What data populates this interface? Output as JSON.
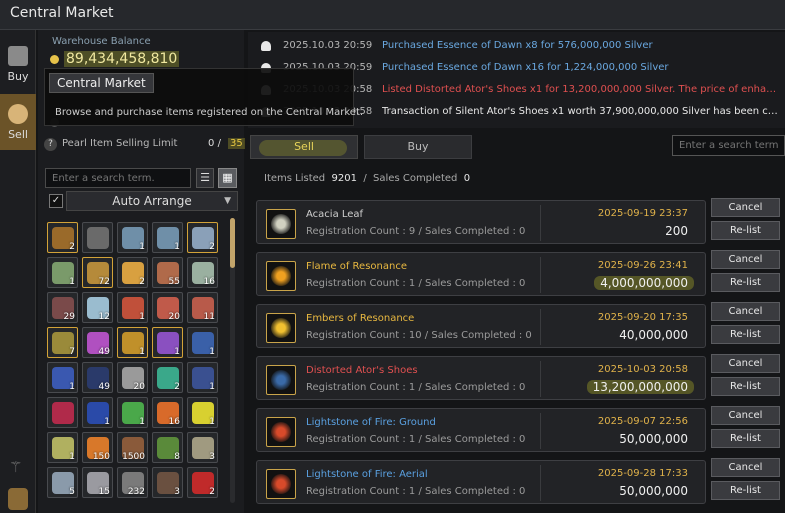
{
  "window": {
    "title": "Central Market"
  },
  "nav": {
    "buy_label": "Buy",
    "sell_label": "Sell"
  },
  "warehouse": {
    "label": "Warehouse Balance",
    "value": "89,434,458,810"
  },
  "tooltip": {
    "title": "Central Market",
    "description": "Browse and purchase items registered on the Central Market."
  },
  "pearl": {
    "label": "Pearl Item Selling Limit",
    "current": "0",
    "separator": "/",
    "max": "35"
  },
  "inventory": {
    "search_placeholder": "Enter a search term.",
    "auto_arrange": "Auto Arrange",
    "checkbox_mark": "✓",
    "slots": [
      {
        "icon": "necklace-icon",
        "count": "2",
        "color": "#9a6a2a",
        "gold": true
      },
      {
        "icon": "ring-icon",
        "count": "",
        "color": "#6a6a6a",
        "gold": false
      },
      {
        "icon": "crystal-icon",
        "count": "1",
        "color": "#6f8fa8",
        "gold": false
      },
      {
        "icon": "crystal-icon",
        "count": "1",
        "color": "#6f8fa8",
        "gold": false
      },
      {
        "icon": "crystal-icon",
        "count": "2",
        "color": "#8aa0b8",
        "gold": true
      },
      {
        "icon": "hoe-icon",
        "count": "1",
        "color": "#7a9a6a",
        "gold": false
      },
      {
        "icon": "treasure-map-icon",
        "count": "72",
        "color": "#b58a3a",
        "gold": true
      },
      {
        "icon": "potion-icon",
        "count": "2",
        "color": "#d8a040",
        "gold": false
      },
      {
        "icon": "seed-icon",
        "count": "55",
        "color": "#b06a4a",
        "gold": false
      },
      {
        "icon": "bottle-icon",
        "count": "16",
        "color": "#9ab0a0",
        "gold": false
      },
      {
        "icon": "meat-icon",
        "count": "29",
        "color": "#7a4a4a",
        "gold": false
      },
      {
        "icon": "feather-icon",
        "count": "12",
        "color": "#9abccf",
        "gold": false
      },
      {
        "icon": "mushroom-icon",
        "count": "1",
        "color": "#c0503a",
        "gold": false
      },
      {
        "icon": "mushroom-icon",
        "count": "20",
        "color": "#c05a4a",
        "gold": false
      },
      {
        "icon": "mushroom-icon",
        "count": "11",
        "color": "#b85a4a",
        "gold": false
      },
      {
        "icon": "key-icon",
        "count": "7",
        "color": "#9a8a3a",
        "gold": true
      },
      {
        "icon": "flask-icon",
        "count": "49",
        "color": "#b050c0",
        "gold": false
      },
      {
        "icon": "stone-icon",
        "count": "1",
        "color": "#c0902a",
        "gold": true
      },
      {
        "icon": "orb-icon",
        "count": "1",
        "color": "#8a50c0",
        "gold": true
      },
      {
        "icon": "gem-icon",
        "count": "1",
        "color": "#3a60a8",
        "gold": false
      },
      {
        "icon": "gem-icon",
        "count": "1",
        "color": "#3a58b0",
        "gold": false
      },
      {
        "icon": "gem-icon",
        "count": "49",
        "color": "#2a3a6a",
        "gold": false
      },
      {
        "icon": "scroll-icon",
        "count": "20",
        "color": "#9a9a9a",
        "gold": false
      },
      {
        "icon": "gem-icon",
        "count": "2",
        "color": "#3aa88a",
        "gold": false
      },
      {
        "icon": "gem-icon",
        "count": "1",
        "color": "#3a5090",
        "gold": false
      },
      {
        "icon": "gem-icon",
        "count": "",
        "color": "#b02a4a",
        "gold": false
      },
      {
        "icon": "gem-icon",
        "count": "1",
        "color": "#2a4aa8",
        "gold": false
      },
      {
        "icon": "leaf-icon",
        "count": "1",
        "color": "#4aa84a",
        "gold": false
      },
      {
        "icon": "carrot-icon",
        "count": "16",
        "color": "#d86a2a",
        "gold": false
      },
      {
        "icon": "coin-icon",
        "count": "1",
        "color": "#d8d030",
        "gold": false
      },
      {
        "icon": "bowl-icon",
        "count": "1",
        "color": "#b0b060",
        "gold": false
      },
      {
        "icon": "carrot-icon",
        "count": "150",
        "color": "#d8782a",
        "gold": false
      },
      {
        "icon": "box-icon",
        "count": "1500",
        "color": "#8a5a3a",
        "gold": false
      },
      {
        "icon": "herb-icon",
        "count": "8",
        "color": "#5a8a3a",
        "gold": false
      },
      {
        "icon": "shell-icon",
        "count": "3",
        "color": "#a09a80",
        "gold": false
      },
      {
        "icon": "fish-icon",
        "count": "5",
        "color": "#8a9aaa",
        "gold": false
      },
      {
        "icon": "claw-icon",
        "count": "15",
        "color": "#9a9aa0",
        "gold": false
      },
      {
        "icon": "scale-icon",
        "count": "232",
        "color": "#7a7a7a",
        "gold": false
      },
      {
        "icon": "pot-icon",
        "count": "3",
        "color": "#6a5040",
        "gold": false
      },
      {
        "icon": "rose-icon",
        "count": "2",
        "color": "#c02a2a",
        "gold": false
      }
    ]
  },
  "notifications": [
    {
      "time": "2025.10.03 20:59",
      "text": "Purchased Essence of Dawn x8 for 576,000,000 Silver",
      "color": "#6aa8e0"
    },
    {
      "time": "2025.10.03 20:59",
      "text": "Purchased Essence of Dawn x16 for 1,224,000,000 Silver",
      "color": "#6aa8e0"
    },
    {
      "time": "2025.10.03 20:58",
      "text": "Listed Distorted Ator's Shoes x1 for 13,200,000,000 Silver. The price of enhanc...",
      "color": "#e05050"
    },
    {
      "time": "2025.10.03 20:58",
      "text": "Transaction of Silent Ator's Shoes x1 worth 37,900,000,000 Silver has been co...",
      "color": "#e8e8e8"
    }
  ],
  "tabs": {
    "sell": "Sell",
    "buy": "Buy",
    "search_placeholder": "Enter a search term."
  },
  "summary": {
    "listed_label": "Items Listed",
    "listed": "9201",
    "sep": "/",
    "completed_label": "Sales Completed",
    "completed": "0"
  },
  "listings": [
    {
      "name": "Acacia Leaf",
      "name_color": "#cfcfcf",
      "reg": "Registration Count : 9 / Sales Completed : 0",
      "date": "2025-09-19 23:37",
      "price": "200",
      "highlight": false,
      "icon": "leaf-icon",
      "icon_color": "#d0d0c0"
    },
    {
      "name": "Flame of Resonance",
      "name_color": "#e8b840",
      "reg": "Registration Count : 1 / Sales Completed : 0",
      "date": "2025-09-26 23:41",
      "price": "4,000,000,000",
      "highlight": true,
      "icon": "flame-icon",
      "icon_color": "#f0a020"
    },
    {
      "name": "Embers of Resonance",
      "name_color": "#e8b840",
      "reg": "Registration Count : 10 / Sales Completed : 0",
      "date": "2025-09-20 17:35",
      "price": "40,000,000",
      "highlight": false,
      "icon": "ember-icon",
      "icon_color": "#f0c030"
    },
    {
      "name": "Distorted Ator's Shoes",
      "name_color": "#e05050",
      "reg": "Registration Count : 1 / Sales Completed : 0",
      "date": "2025-10-03 20:58",
      "price": "13,200,000,000",
      "highlight": true,
      "icon": "shoes-icon",
      "icon_color": "#3a6aa8"
    },
    {
      "name": "Lightstone of Fire: Ground",
      "name_color": "#5aa0e0",
      "reg": "Registration Count : 1 / Sales Completed : 0",
      "date": "2025-09-07 22:56",
      "price": "50,000,000",
      "highlight": false,
      "icon": "lightstone-icon",
      "icon_color": "#d84a2a"
    },
    {
      "name": "Lightstone of Fire: Aerial",
      "name_color": "#5aa0e0",
      "reg": "Registration Count : 1 / Sales Completed : 0",
      "date": "2025-09-28 17:33",
      "price": "50,000,000",
      "highlight": false,
      "icon": "lightstone-icon",
      "icon_color": "#d84a2a"
    }
  ],
  "buttons": {
    "cancel": "Cancel",
    "relist": "Re-list"
  }
}
